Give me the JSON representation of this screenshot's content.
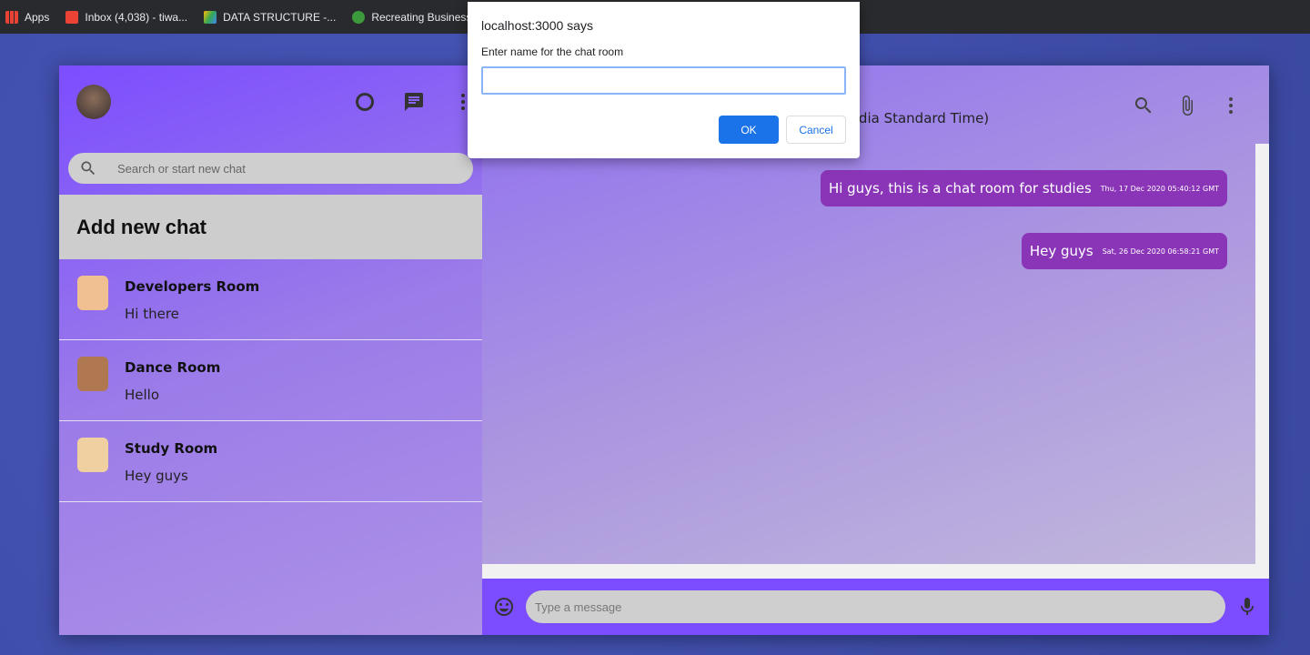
{
  "bookmarks": [
    {
      "label": "Apps",
      "icon": "apps-grid-icon"
    },
    {
      "label": "Inbox (4,038) - tiwa...",
      "icon": "gmail-icon"
    },
    {
      "label": "DATA STRUCTURE -...",
      "icon": "google-drive-icon"
    },
    {
      "label": "Recreating Business...",
      "icon": "leaf-icon"
    }
  ],
  "sidebar": {
    "search_placeholder": "Search or start new chat",
    "add_new": "Add new chat",
    "rooms": [
      {
        "name": "Developers Room",
        "last": "Hi there",
        "color": "#f0c090"
      },
      {
        "name": "Dance Room",
        "last": "Hello",
        "color": "#b07850"
      },
      {
        "name": "Study Room",
        "last": "Hey guys",
        "color": "#f0d0a0"
      }
    ]
  },
  "chat": {
    "last_seen": "India Standard Time)",
    "message_placeholder": "Type a message",
    "messages": [
      {
        "text": "Hi guys, this is a chat room for studies",
        "time": "Thu, 17 Dec 2020 05:40:12 GMT"
      },
      {
        "text": "Hey guys",
        "time": "Sat, 26 Dec 2020 06:58:21 GMT"
      }
    ]
  },
  "dialog": {
    "title": "localhost:3000 says",
    "prompt": "Enter name for the chat room",
    "value": "",
    "ok": "OK",
    "cancel": "Cancel"
  },
  "colors": {
    "sidebar": "#7c4dff",
    "bubble": "#8a35b8",
    "ok": "#1a73e8"
  }
}
